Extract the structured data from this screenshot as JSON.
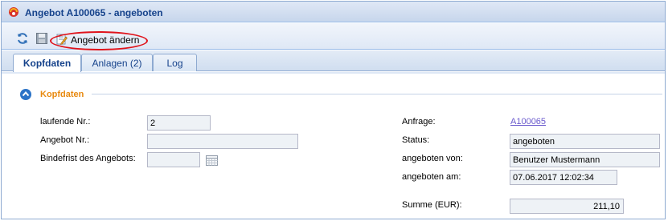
{
  "window": {
    "title": "Angebot A100065 - angeboten"
  },
  "toolbar": {
    "refresh_icon": "refresh-icon",
    "save_icon": "save-icon",
    "edit_label": "Angebot ändern",
    "edit_icon": "edit-document-icon",
    "highlight_color": "#e0141c"
  },
  "tabs": [
    {
      "label": "Kopfdaten",
      "active": true
    },
    {
      "label": "Anlagen (2)",
      "active": false
    },
    {
      "label": "Log",
      "active": false
    }
  ],
  "section": {
    "title": "Kopfdaten",
    "title_color": "#e88a10",
    "collapse_icon": "collapse-up-icon"
  },
  "form_left": {
    "laufende_nr": {
      "label": "laufende Nr.:",
      "value": "2"
    },
    "angebot_nr": {
      "label": "Angebot Nr.:",
      "value": ""
    },
    "bindefrist": {
      "label": "Bindefrist des Angebots:",
      "value": "",
      "icon": "calendar-icon"
    }
  },
  "form_right": {
    "anfrage": {
      "label": "Anfrage:",
      "value": "A100065"
    },
    "status": {
      "label": "Status:",
      "value": "angeboten"
    },
    "angeboten_von": {
      "label": "angeboten von:",
      "value": "Benutzer Mustermann"
    },
    "angeboten_am": {
      "label": "angeboten am:",
      "value": "07.06.2017 12:02:34"
    },
    "summe": {
      "label": "Summe (EUR):",
      "value": "211,10"
    }
  }
}
